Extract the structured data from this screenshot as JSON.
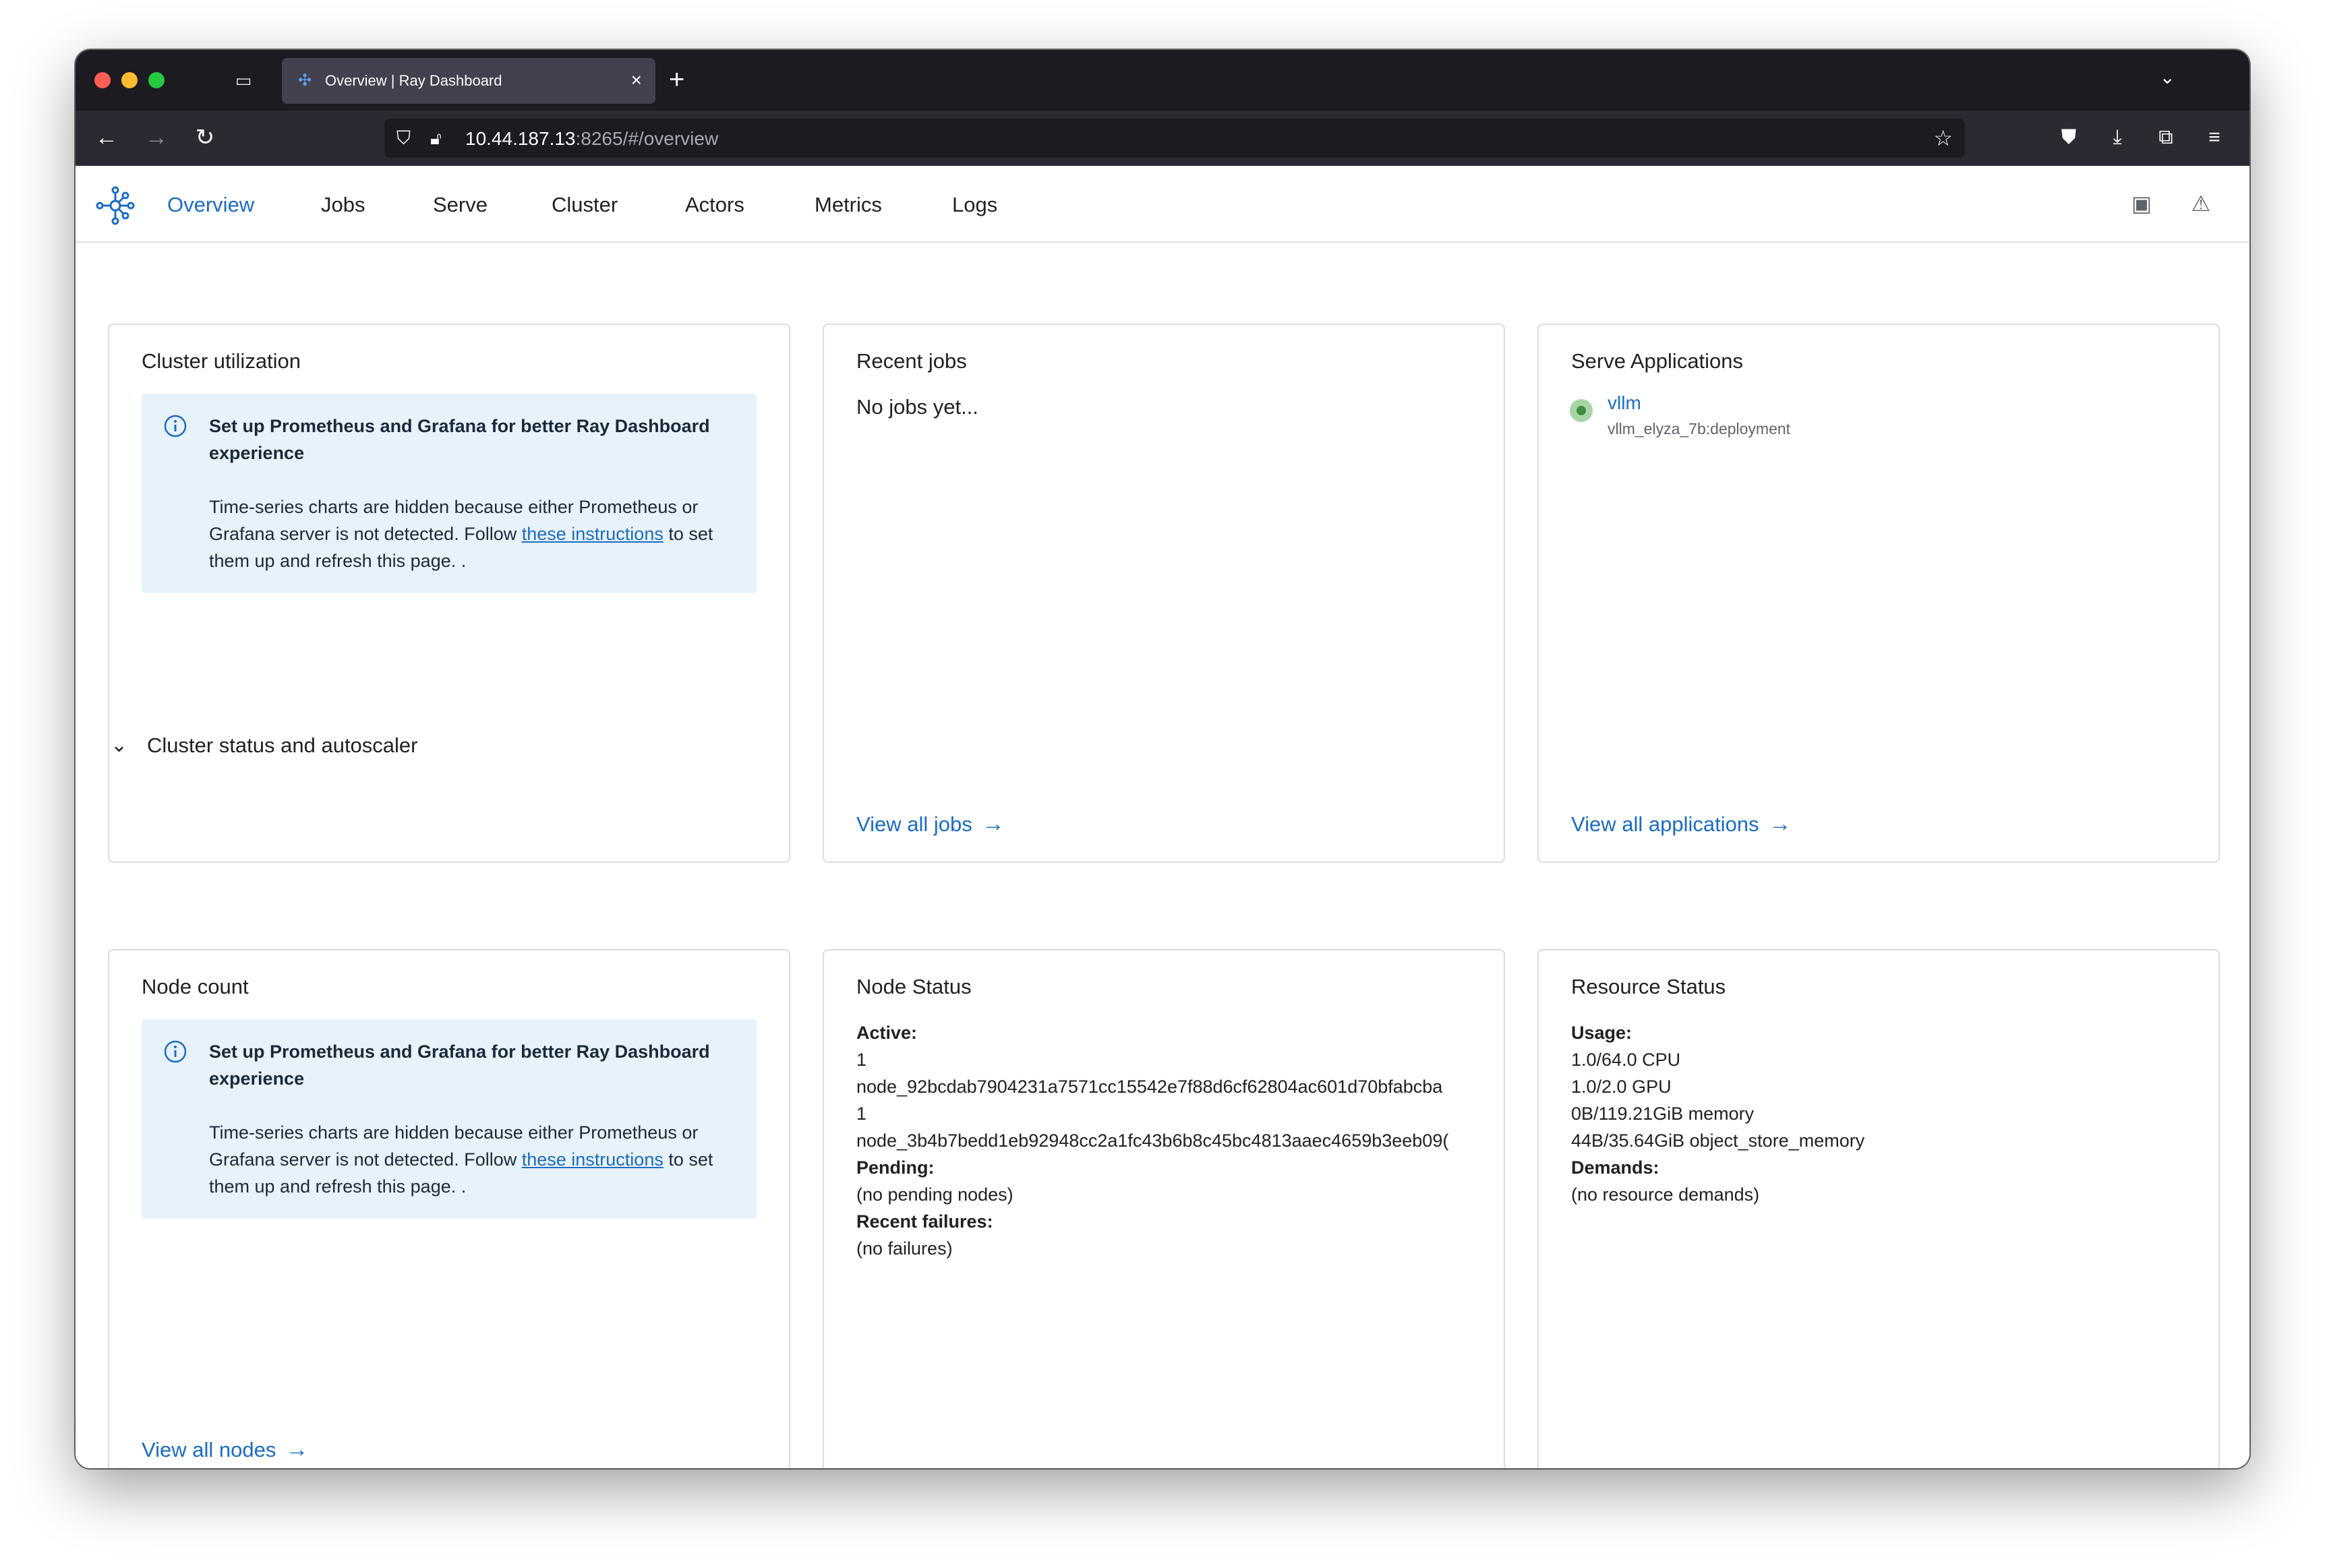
{
  "browser": {
    "tab_title": "Overview | Ray Dashboard",
    "url_host": "10.44.187.13",
    "url_rest": ":8265/#/overview"
  },
  "nav": {
    "items": [
      "Overview",
      "Jobs",
      "Serve",
      "Cluster",
      "Actors",
      "Metrics",
      "Logs"
    ],
    "active": "Overview"
  },
  "cluster_utilization": {
    "title": "Cluster utilization",
    "info_heading": "Set up Prometheus and Grafana for better Ray Dashboard experience",
    "info_body_pre": "Time-series charts are hidden because either Prometheus or Grafana server is not detected. Follow ",
    "info_link": "these instructions",
    "info_body_post": " to set them up and refresh this page. ."
  },
  "recent_jobs": {
    "title": "Recent jobs",
    "empty_text": "No jobs yet...",
    "link": "View all jobs"
  },
  "serve_applications": {
    "title": "Serve Applications",
    "apps": [
      {
        "name": "vllm",
        "deployment": "vllm_elyza_7b:deployment",
        "status_color": "#3d8c40"
      }
    ],
    "link": "View all applications"
  },
  "section": {
    "title": "Cluster status and autoscaler"
  },
  "node_count": {
    "title": "Node count",
    "info_heading": "Set up Prometheus and Grafana for better Ray Dashboard experience",
    "info_body_pre": "Time-series charts are hidden because either Prometheus or Grafana server is not detected. Follow ",
    "info_link": "these instructions",
    "info_body_post": " to set them up and refresh this page. .",
    "link": "View all nodes"
  },
  "node_status": {
    "title": "Node Status",
    "active_label": "Active:",
    "active_1_count": "1",
    "active_1_node": "node_92bcdab7904231a7571cc15542e7f88d6cf62804ac601d70bfabcba",
    "active_2_count": "1",
    "active_2_node": "node_3b4b7bedd1eb92948cc2a1fc43b6b8c45bc4813aaec4659b3eeb09(",
    "pending_label": "Pending:",
    "pending_value": "(no pending nodes)",
    "failures_label": "Recent failures:",
    "failures_value": "(no failures)"
  },
  "resource_status": {
    "title": "Resource Status",
    "usage_label": "Usage:",
    "cpu": "1.0/64.0 CPU",
    "gpu": "1.0/2.0 GPU",
    "memory": "0B/119.21GiB memory",
    "object_store": "44B/35.64GiB object_store_memory",
    "demands_label": "Demands:",
    "demands_value": "(no resource demands)"
  }
}
